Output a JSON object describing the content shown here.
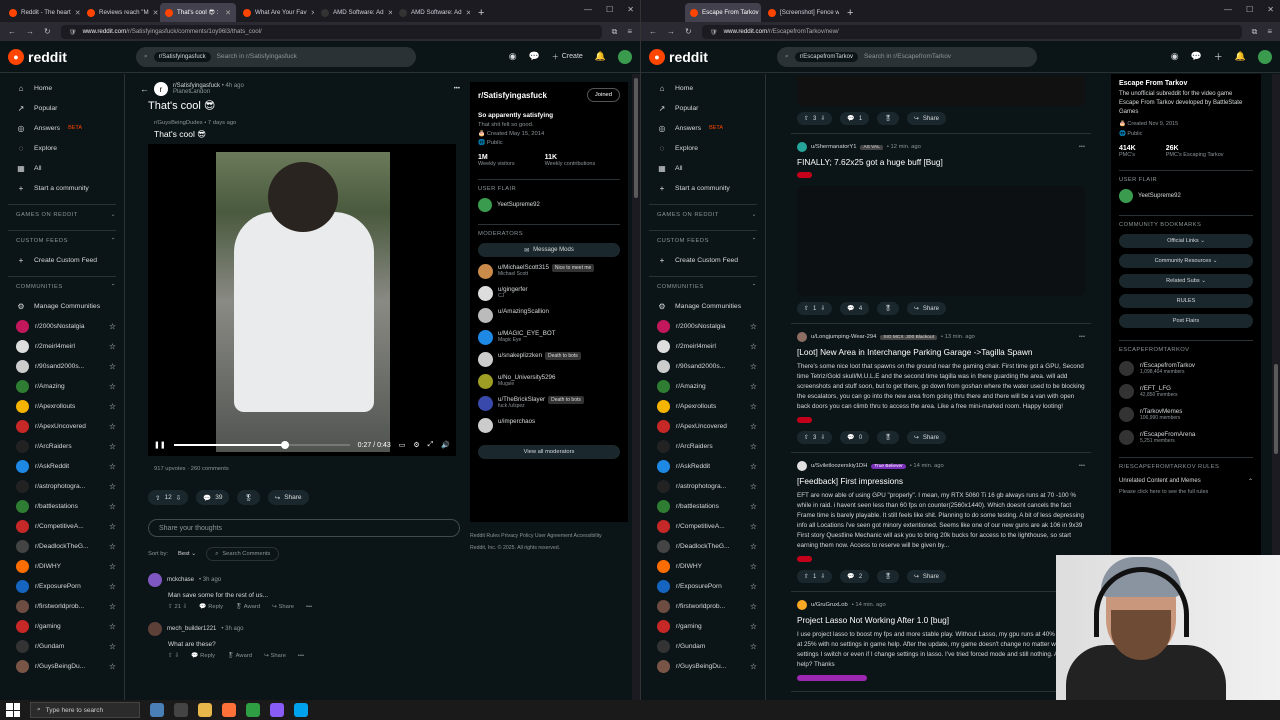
{
  "left": {
    "tabs": [
      {
        "label": "Reddit - The heart",
        "color": "#ff4500"
      },
      {
        "label": "Reviews reach \"M",
        "color": "#ff4500"
      },
      {
        "label": "That's cool 😎 :",
        "color": "#ff4500",
        "active": true
      },
      {
        "label": "What Are Your Fav",
        "color": "#ff4500"
      },
      {
        "label": "AMD Software: Ad",
        "color": "#333"
      },
      {
        "label": "AMD Software: Ad",
        "color": "#333"
      }
    ],
    "url_domain": "www.reddit.com",
    "url_path": "/r/Satisfyingasfuck/comments/1oy96l3/thats_cool/",
    "search_chip": "r/Satisfyingasfuck",
    "search_placeholder": "Search in r/Satisfyingasfuck",
    "create_label": "Create",
    "nav": [
      {
        "icon": "⌂",
        "name": "home-icon",
        "label": "Home"
      },
      {
        "icon": "↗",
        "name": "popular-icon",
        "label": "Popular"
      },
      {
        "icon": "◎",
        "name": "answers-icon",
        "label": "Answers",
        "badge": "BETA"
      },
      {
        "icon": "◌",
        "name": "explore-icon",
        "label": "Explore"
      },
      {
        "icon": "▦",
        "name": "all-icon",
        "label": "All"
      },
      {
        "icon": "+",
        "name": "plus-icon",
        "label": "Start a community"
      }
    ],
    "sec_games": "GAMES ON REDDIT",
    "sec_feeds": "CUSTOM FEEDS",
    "create_feed": "Create Custom Feed",
    "sec_comm": "COMMUNITIES",
    "manage": "Manage Communities",
    "communities": [
      {
        "name": "r/2000sNostalgia",
        "color": "#c2185b"
      },
      {
        "name": "r/2meirl4meirl",
        "color": "#ddd"
      },
      {
        "name": "r/90sand2000s...",
        "color": "#ccc"
      },
      {
        "name": "r/Amazing",
        "color": "#2e7d32"
      },
      {
        "name": "r/Apexrollouts",
        "color": "#f4b400"
      },
      {
        "name": "r/ApexUncovered",
        "color": "#c62828"
      },
      {
        "name": "r/ArcRaiders",
        "color": "#222"
      },
      {
        "name": "r/AskReddit",
        "color": "#1e88e5"
      },
      {
        "name": "r/astrophotogra...",
        "color": "#222"
      },
      {
        "name": "r/battlestations",
        "color": "#2e7d32"
      },
      {
        "name": "r/CompetitiveA...",
        "color": "#c62828"
      },
      {
        "name": "r/DeadlockTheG...",
        "color": "#444"
      },
      {
        "name": "r/DIWHY",
        "color": "#ff6d00"
      },
      {
        "name": "r/ExposurePorn",
        "color": "#1565c0"
      },
      {
        "name": "r/firstworldprob...",
        "color": "#6d4c41"
      },
      {
        "name": "r/gaming",
        "color": "#c62828"
      },
      {
        "name": "r/Gundam",
        "color": "#333"
      },
      {
        "name": "r/GuysBeingDu...",
        "color": "#795548"
      }
    ],
    "post": {
      "sub": "r/Satisfyingasfuck",
      "time": "• 4h ago",
      "user": "PlanetLandon",
      "title": "That's cool 😎",
      "xpost_sub": "r/GuysBeingDudes",
      "xpost_time": "• 7 days ago",
      "xpost_title": "That's cool 😎",
      "video_time": "0:27 / 0:43",
      "progress": 0.63,
      "stats": "917 upvotes · 260 comments",
      "votes": "12",
      "comments": "39",
      "share": "Share",
      "reply_ph": "Share your thoughts",
      "sort_label": "Sort by:",
      "sort_value": "Best ⌄",
      "search_comments": "Search Comments"
    },
    "comments": [
      {
        "user": "mckchase",
        "time": "• 3h ago",
        "text": "Man save some for the rest of us...",
        "votes": "21",
        "color": "#7e57c2"
      },
      {
        "user": "mech_builder1221",
        "time": "• 3h ago",
        "text": "What are these?",
        "votes": "",
        "color": "#5d4037"
      }
    ],
    "cmt_reply": "Reply",
    "cmt_award": "Award",
    "cmt_share": "Share",
    "sidebar": {
      "title": "r/Satisfyingasfuck",
      "joined": "Joined",
      "subtitle": "So apparently satisfying",
      "desc": "That shit felt so good.",
      "created": "Created May 15, 2014",
      "public": "Public",
      "n1": "1M",
      "l1": "Weekly visitors",
      "n2": "11K",
      "l2": "Weekly contributions",
      "flair_h": "USER FLAIR",
      "flair_user": "YeetSupreme92",
      "mods_h": "MODERATORS",
      "msg_mods": "Message Mods",
      "mods": [
        {
          "name": "u/MichaelScott315",
          "flair": "Michael Scott",
          "tag": "Nice to meet me",
          "color": "#c98a4a"
        },
        {
          "name": "u/gingerfer",
          "flair": "CJ",
          "tag": "",
          "color": "#ddd"
        },
        {
          "name": "u/AmazingScallion",
          "flair": "",
          "tag": "",
          "color": "#bbb"
        },
        {
          "name": "u/MAGIC_EYE_BOT",
          "flair": "Magic Eye",
          "tag": "",
          "color": "#1e88e5"
        },
        {
          "name": "u/snakeplizzken",
          "flair": "",
          "tag": "Death to bots",
          "color": "#ccc"
        },
        {
          "name": "u/No_University5296",
          "flair": "Mugsie",
          "tag": "",
          "color": "#9e9d24"
        },
        {
          "name": "u/TheBrickSlayer",
          "flair": "fuck /u/spez",
          "tag": "Death to bots",
          "color": "#3949ab"
        },
        {
          "name": "u/imperchaos",
          "flair": "",
          "tag": "",
          "color": "#ccc"
        }
      ],
      "view_all": "View all moderators",
      "footer1": "Reddit Rules  Privacy Policy  User Agreement  Accessibility",
      "footer2": "Reddit, Inc. © 2025. All rights reserved."
    }
  },
  "right": {
    "tabs": [
      {
        "label": "Escape From Tarkov",
        "color": "#ff4500",
        "active": true
      },
      {
        "label": "[Screenshot] Fence what kind o",
        "color": "#ff4500"
      }
    ],
    "url_domain": "www.reddit.com",
    "url_path": "/r/EscapefromTarkov/new/",
    "search_chip": "r/EscapefromTarkov",
    "search_placeholder": "Search in r/EscapefromTarkov",
    "posts": [
      {
        "user": "u/ShermanatorY1",
        "flair": "AS VAL",
        "time": "• 12 min. ago",
        "title": "FINALLY; 7.62x25 got a huge buff [Bug]",
        "body": "",
        "votes": "1",
        "comments": "4",
        "img": true,
        "tag": "red",
        "color": "#26a69a"
      },
      {
        "user": "u/Longjumping-Wear-294",
        "flair": "SIG MCX .300 Blackout",
        "time": "• 13 min. ago",
        "title": "[Loot] New Area in Interchange Parking Garage ->Tagilla Spawn",
        "body": "There's some nice loot that spawns on the ground near the gaming chair. First time got a GPU, Second time Tetriz/Gold skull/M.U.L.E and the second time tagilla was in there guarding the area. will add screenshots and stuff soon, but to get there, go down from goshan where the water used to be blocking the escalators, you can go into the new area from going thru there and there will be a van with open back doors you can climb thru to access the area. Like a free mini-marked room. Happy looting!",
        "votes": "3",
        "comments": "0",
        "img": false,
        "tag": "red",
        "color": "#8d6e63"
      },
      {
        "user": "u/Sviletloozerskiy1DH",
        "flair": "True Believer",
        "time": "• 14 min. ago",
        "title": "[Feedback] First impressions",
        "body": "EFT are now able of using GPU \"properly\". I mean, my RTX 5060 Ti 16 gb always runs at 70 -100 % while in raid. i havent seen less than 60 fps on counter(2560x1440). Which doesnt cancels the fact Frame time is barely playable. It still feels like shit. Planning to do some testing. A bit of less depressing info all Locations i've seen got minory extentioned. Seems like one of our new guns are ak 106 in 9x39 First story Questline Mechanic will ask you to bring 20k bucks for access to the lighthouse, so start earning them now. Access to reserve will be given by...",
        "votes": "1",
        "comments": "2",
        "img": false,
        "tag": "red",
        "color": "#e0e0e0"
      },
      {
        "user": "u/GruGruxLob",
        "flair": "",
        "time": "• 14 min. ago",
        "title": "Project Lasso Not Working After 1.0 [bug]",
        "body": "I use project lasso to boost my fps and more stable play. Without Lasso, my gpu runs at 40% and cpu at 25% with no settings in game help. After the update, my game doesn't change no matter what settings I switch or even if I change settings in lasso. I've tried forced mode and still nothing. Anyone help? Thanks",
        "votes": "",
        "comments": "",
        "img": false,
        "tag": "purple",
        "color": "#f9a825"
      }
    ],
    "top_votes": "3",
    "top_comments": "1",
    "share": "Share",
    "sidebar": {
      "title": "Escape From Tarkov",
      "desc": "The unofficial subreddit for the video game Escape From Tarkov developed by BattleState Games",
      "created": "Created Nov 9, 2015",
      "public": "Public",
      "n1": "414K",
      "l1": "PMC's",
      "n2": "26K",
      "l2": "PMC's Escaping Tarkov",
      "flair_h": "USER FLAIR",
      "flair_user": "YeetSupreme92",
      "bm_h": "COMMUNITY BOOKMARKS",
      "bookmarks": [
        "Official Links ⌄",
        "Community Resources ⌄",
        "Related Subs ⌄",
        "RULES",
        "Post Flairs"
      ],
      "rel_h": "ESCAPEFROMTARKOV",
      "related": [
        {
          "name": "r/EscapefromTarkov",
          "members": "1,098,404 members"
        },
        {
          "name": "r/EFT_LFG",
          "members": "42,850 members"
        },
        {
          "name": "r/TarkovMemes",
          "members": "106,990 members"
        },
        {
          "name": "r/EscapeFromArena",
          "members": "5,251 members"
        }
      ],
      "rules_h": "R/ESCAPEFROMTARKOV RULES",
      "rule1": "Unrelated Content and Memes",
      "rule1_p": "Please click here to see the full rules"
    }
  },
  "taskbar": {
    "search": "Type here to search"
  }
}
